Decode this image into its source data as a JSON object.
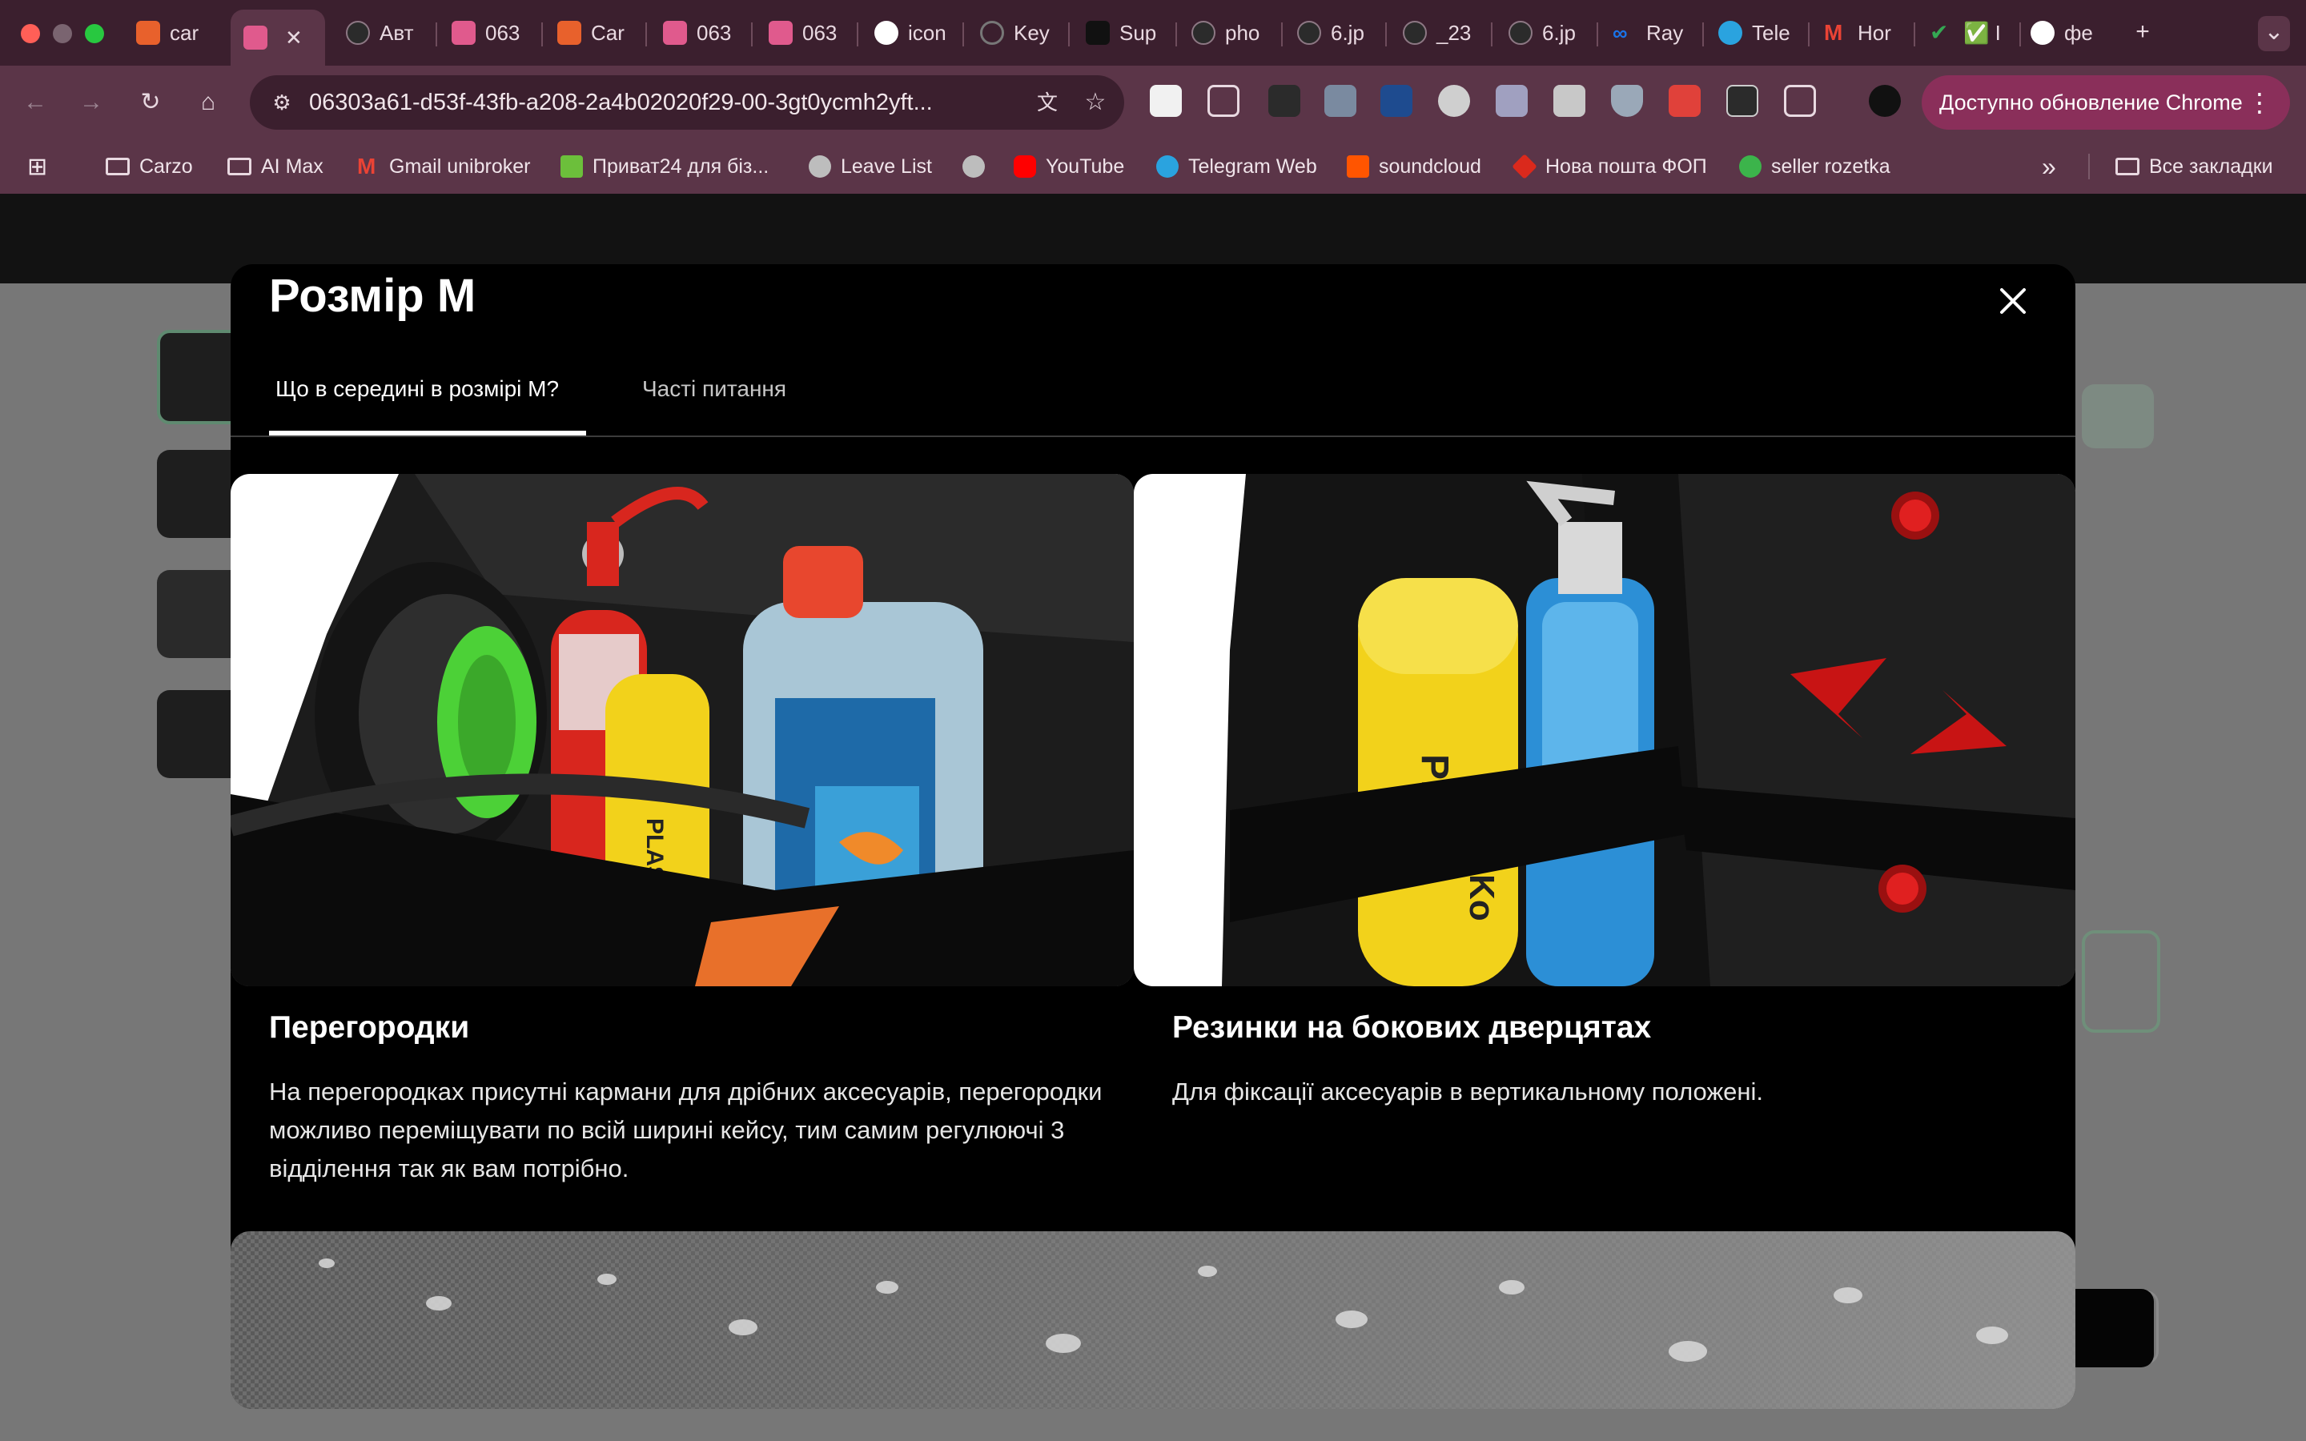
{
  "browser": {
    "tabs": [
      {
        "label": "car",
        "color": "#e8612c"
      },
      {
        "label": "",
        "color": "#e05a8d",
        "active": true
      },
      {
        "label": "Авт",
        "color": "#2b2b2b"
      },
      {
        "label": "063",
        "color": "#e05a8d"
      },
      {
        "label": "Car",
        "color": "#e8612c"
      },
      {
        "label": "063",
        "color": "#e05a8d"
      },
      {
        "label": "063",
        "color": "#e05a8d"
      },
      {
        "label": "icon",
        "color": "#ffffff"
      },
      {
        "label": "Key",
        "color": "#555555"
      },
      {
        "label": "Sup",
        "color": "#111111"
      },
      {
        "label": "pho",
        "color": "#2b2b2b"
      },
      {
        "label": "6.jp",
        "color": "#2b2b2b"
      },
      {
        "label": "_23",
        "color": "#2b2b2b"
      },
      {
        "label": "6.jp",
        "color": "#2b2b2b"
      },
      {
        "label": "Ray",
        "color": "#1a73e8"
      },
      {
        "label": "Tele",
        "color": "#2aa3df"
      },
      {
        "label": "Hor",
        "color": "#ea4335"
      },
      {
        "label": "✅ I",
        "color": "#34a853"
      },
      {
        "label": "фе",
        "color": "#ffffff"
      }
    ],
    "tab_close": "✕",
    "new_tab": "+",
    "tab_menu": "⌄",
    "url": "06303a61-d53f-43fb-a208-2a4b02020f29-00-3gt0ycmh2yft...",
    "update_button": "Доступно обновление Chrome",
    "nav": {
      "back": "←",
      "forward": "→",
      "reload": "↻",
      "home": "⌂",
      "star": "☆",
      "menu": "⋮"
    },
    "bookmarks": [
      {
        "label": "Carzo",
        "type": "folder"
      },
      {
        "label": "AI Max",
        "type": "folder"
      },
      {
        "label": "Gmail unibroker",
        "type": "gmail",
        "color": "#ea4335"
      },
      {
        "label": "Приват24 для біз...",
        "type": "site",
        "color": "#6cbf3b"
      },
      {
        "label": "Leave List",
        "type": "globe",
        "color": "#bdbdbd"
      },
      {
        "label": "",
        "type": "globe",
        "color": "#bdbdbd"
      },
      {
        "label": "YouTube",
        "type": "site",
        "color": "#ff0000"
      },
      {
        "label": "Telegram Web",
        "type": "site",
        "color": "#2aa3df"
      },
      {
        "label": "soundcloud",
        "type": "site",
        "color": "#ff5500"
      },
      {
        "label": "Нова пошта ФОП",
        "type": "site",
        "color": "#da291c"
      },
      {
        "label": "seller rozetka",
        "type": "site",
        "color": "#3cb44b"
      }
    ],
    "bookmarks_more": "»",
    "all_bookmarks": "Все закладки"
  },
  "modal": {
    "title": "Розмір М",
    "close_label": "✕",
    "tabs": [
      {
        "label": "Що в середині в розмірі М?",
        "active": true
      },
      {
        "label": "Часті питання",
        "active": false
      }
    ],
    "cards": [
      {
        "title": "Перегородки",
        "text": "На перегородках присутні кармани для дрібних аксесуарів, перегородки можливо переміщувати по всій ширині кейсу, тим самим регулюючі 3 відділення так як вам потрібно."
      },
      {
        "title": "Резинки на бокових дверцятах",
        "text": "Для фіксації аксесуарів в вертикальному положені."
      }
    ]
  },
  "image_text": {
    "bottle_label_1": "PLAS",
    "bottle_label_2": "Ko"
  },
  "colors": {
    "browser_frame": "#3b1f2e",
    "toolbar": "#5b3548",
    "accent_green": "#4cd137",
    "extinguisher_red": "#d8261e",
    "canister_cap": "#e8472e",
    "marker_red": "#e02020"
  }
}
